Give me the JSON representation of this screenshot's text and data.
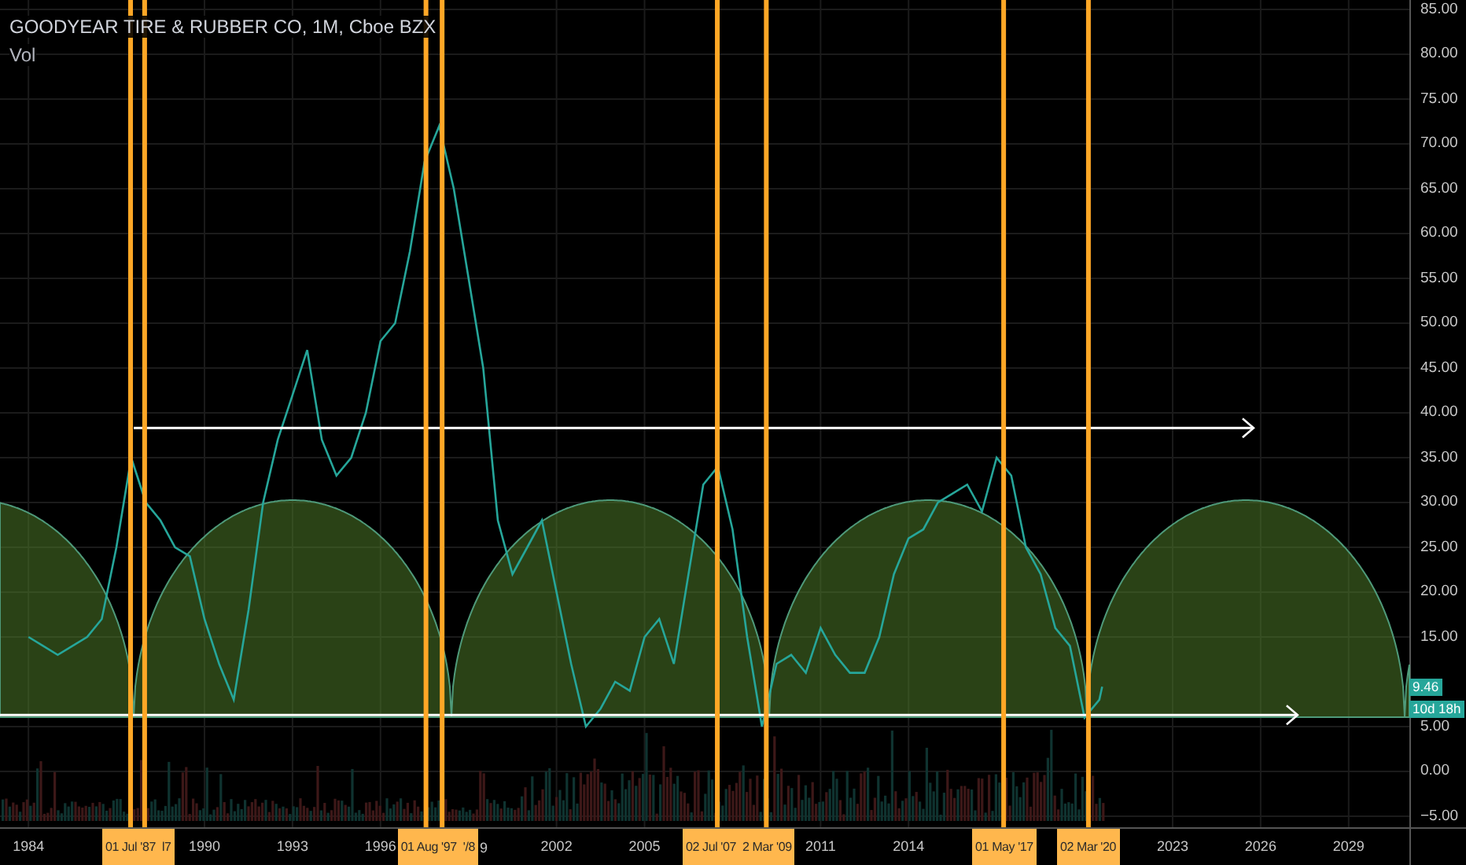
{
  "title": "GOODYEAR TIRE & RUBBER CO, 1M, Cboe BZX",
  "volume_label": "Vol",
  "chart_data": {
    "type": "line",
    "x": [
      1984,
      1984.5,
      1985,
      1985.5,
      1986,
      1986.5,
      1987,
      1987.5,
      1988,
      1988.5,
      1989,
      1989.5,
      1990,
      1990.5,
      1991,
      1991.5,
      1992,
      1992.5,
      1993,
      1993.5,
      1994,
      1994.5,
      1995,
      1995.5,
      1996,
      1996.5,
      1997,
      1997.5,
      1998,
      1998.5,
      1999,
      1999.5,
      2000,
      2000.5,
      2001,
      2001.5,
      2002,
      2002.5,
      2003,
      2003.5,
      2004,
      2004.5,
      2005,
      2005.5,
      2006,
      2006.5,
      2007,
      2007.5,
      2008,
      2008.5,
      2009,
      2009.5,
      2010,
      2010.5,
      2011,
      2011.5,
      2012,
      2012.5,
      2013,
      2013.5,
      2014,
      2014.5,
      2015,
      2015.5,
      2016,
      2016.5,
      2017,
      2017.5,
      2018,
      2018.5,
      2019,
      2019.5,
      2020,
      2020.5,
      2020.6
    ],
    "series": [
      {
        "color": "#26a69a",
        "values": [
          15,
          14,
          13,
          14,
          15,
          17,
          25,
          35,
          30,
          28,
          25,
          24,
          17,
          12,
          8,
          18,
          30,
          37,
          42,
          47,
          37,
          33,
          35,
          40,
          48,
          50,
          58,
          68,
          72,
          65,
          55,
          45,
          28,
          22,
          25,
          28,
          20,
          12,
          5,
          7,
          10,
          9,
          15,
          17,
          12,
          22,
          32,
          34,
          27,
          15,
          5,
          12,
          13,
          11,
          16,
          13,
          11,
          11,
          15,
          22,
          26,
          27,
          30,
          31,
          32,
          29,
          35,
          33,
          25,
          22,
          16,
          14,
          6,
          8,
          9.46
        ]
      }
    ],
    "xlim": [
      1983.03,
      2033.0
    ],
    "ylim": [
      -6.23,
      86.05
    ],
    "grid": true,
    "xticks": [
      {
        "value": 1984,
        "label": "1984"
      },
      {
        "value": 1990,
        "label": "1990"
      },
      {
        "value": 1993,
        "label": "1993"
      },
      {
        "value": 1996,
        "label": "1996"
      },
      {
        "value": 2002,
        "label": "2002"
      },
      {
        "value": 2005,
        "label": "2005"
      },
      {
        "value": 2011,
        "label": "2011"
      },
      {
        "value": 2014,
        "label": "2014"
      },
      {
        "value": 2023,
        "label": "2023"
      },
      {
        "value": 2026,
        "label": "2026"
      },
      {
        "value": 2029,
        "label": "2029"
      }
    ],
    "yticks": [
      {
        "value": 85,
        "label": "85.00"
      },
      {
        "value": 80,
        "label": "80.00"
      },
      {
        "value": 75,
        "label": "75.00"
      },
      {
        "value": 70,
        "label": "70.00"
      },
      {
        "value": 65,
        "label": "65.00"
      },
      {
        "value": 60,
        "label": "60.00"
      },
      {
        "value": 55,
        "label": "55.00"
      },
      {
        "value": 50,
        "label": "50.00"
      },
      {
        "value": 45,
        "label": "45.00"
      },
      {
        "value": 40,
        "label": "40.00"
      },
      {
        "value": 35,
        "label": "35.00"
      },
      {
        "value": 30,
        "label": "30.00"
      },
      {
        "value": 25,
        "label": "25.00"
      },
      {
        "value": 20,
        "label": "20.00"
      },
      {
        "value": 15,
        "label": "15.00"
      },
      {
        "value": 5,
        "label": "5.00"
      },
      {
        "value": 0,
        "label": "0.00"
      },
      {
        "value": -5,
        "label": "−5.00"
      }
    ]
  },
  "cycle_markers": [
    {
      "labels": [
        "01 Jul '87",
        "l7"
      ]
    },
    {
      "labels": [
        "01 Aug '97",
        "'/8"
      ],
      "year_fragment": "9"
    },
    {
      "labels": [
        "02 Jul '07",
        "2 Mar '09"
      ]
    },
    {
      "labels": [
        "01 May '17"
      ]
    },
    {
      "labels": [
        "02 Mar '20"
      ]
    }
  ],
  "price_tag": "9.46",
  "countdown_tag": "10d 18h"
}
